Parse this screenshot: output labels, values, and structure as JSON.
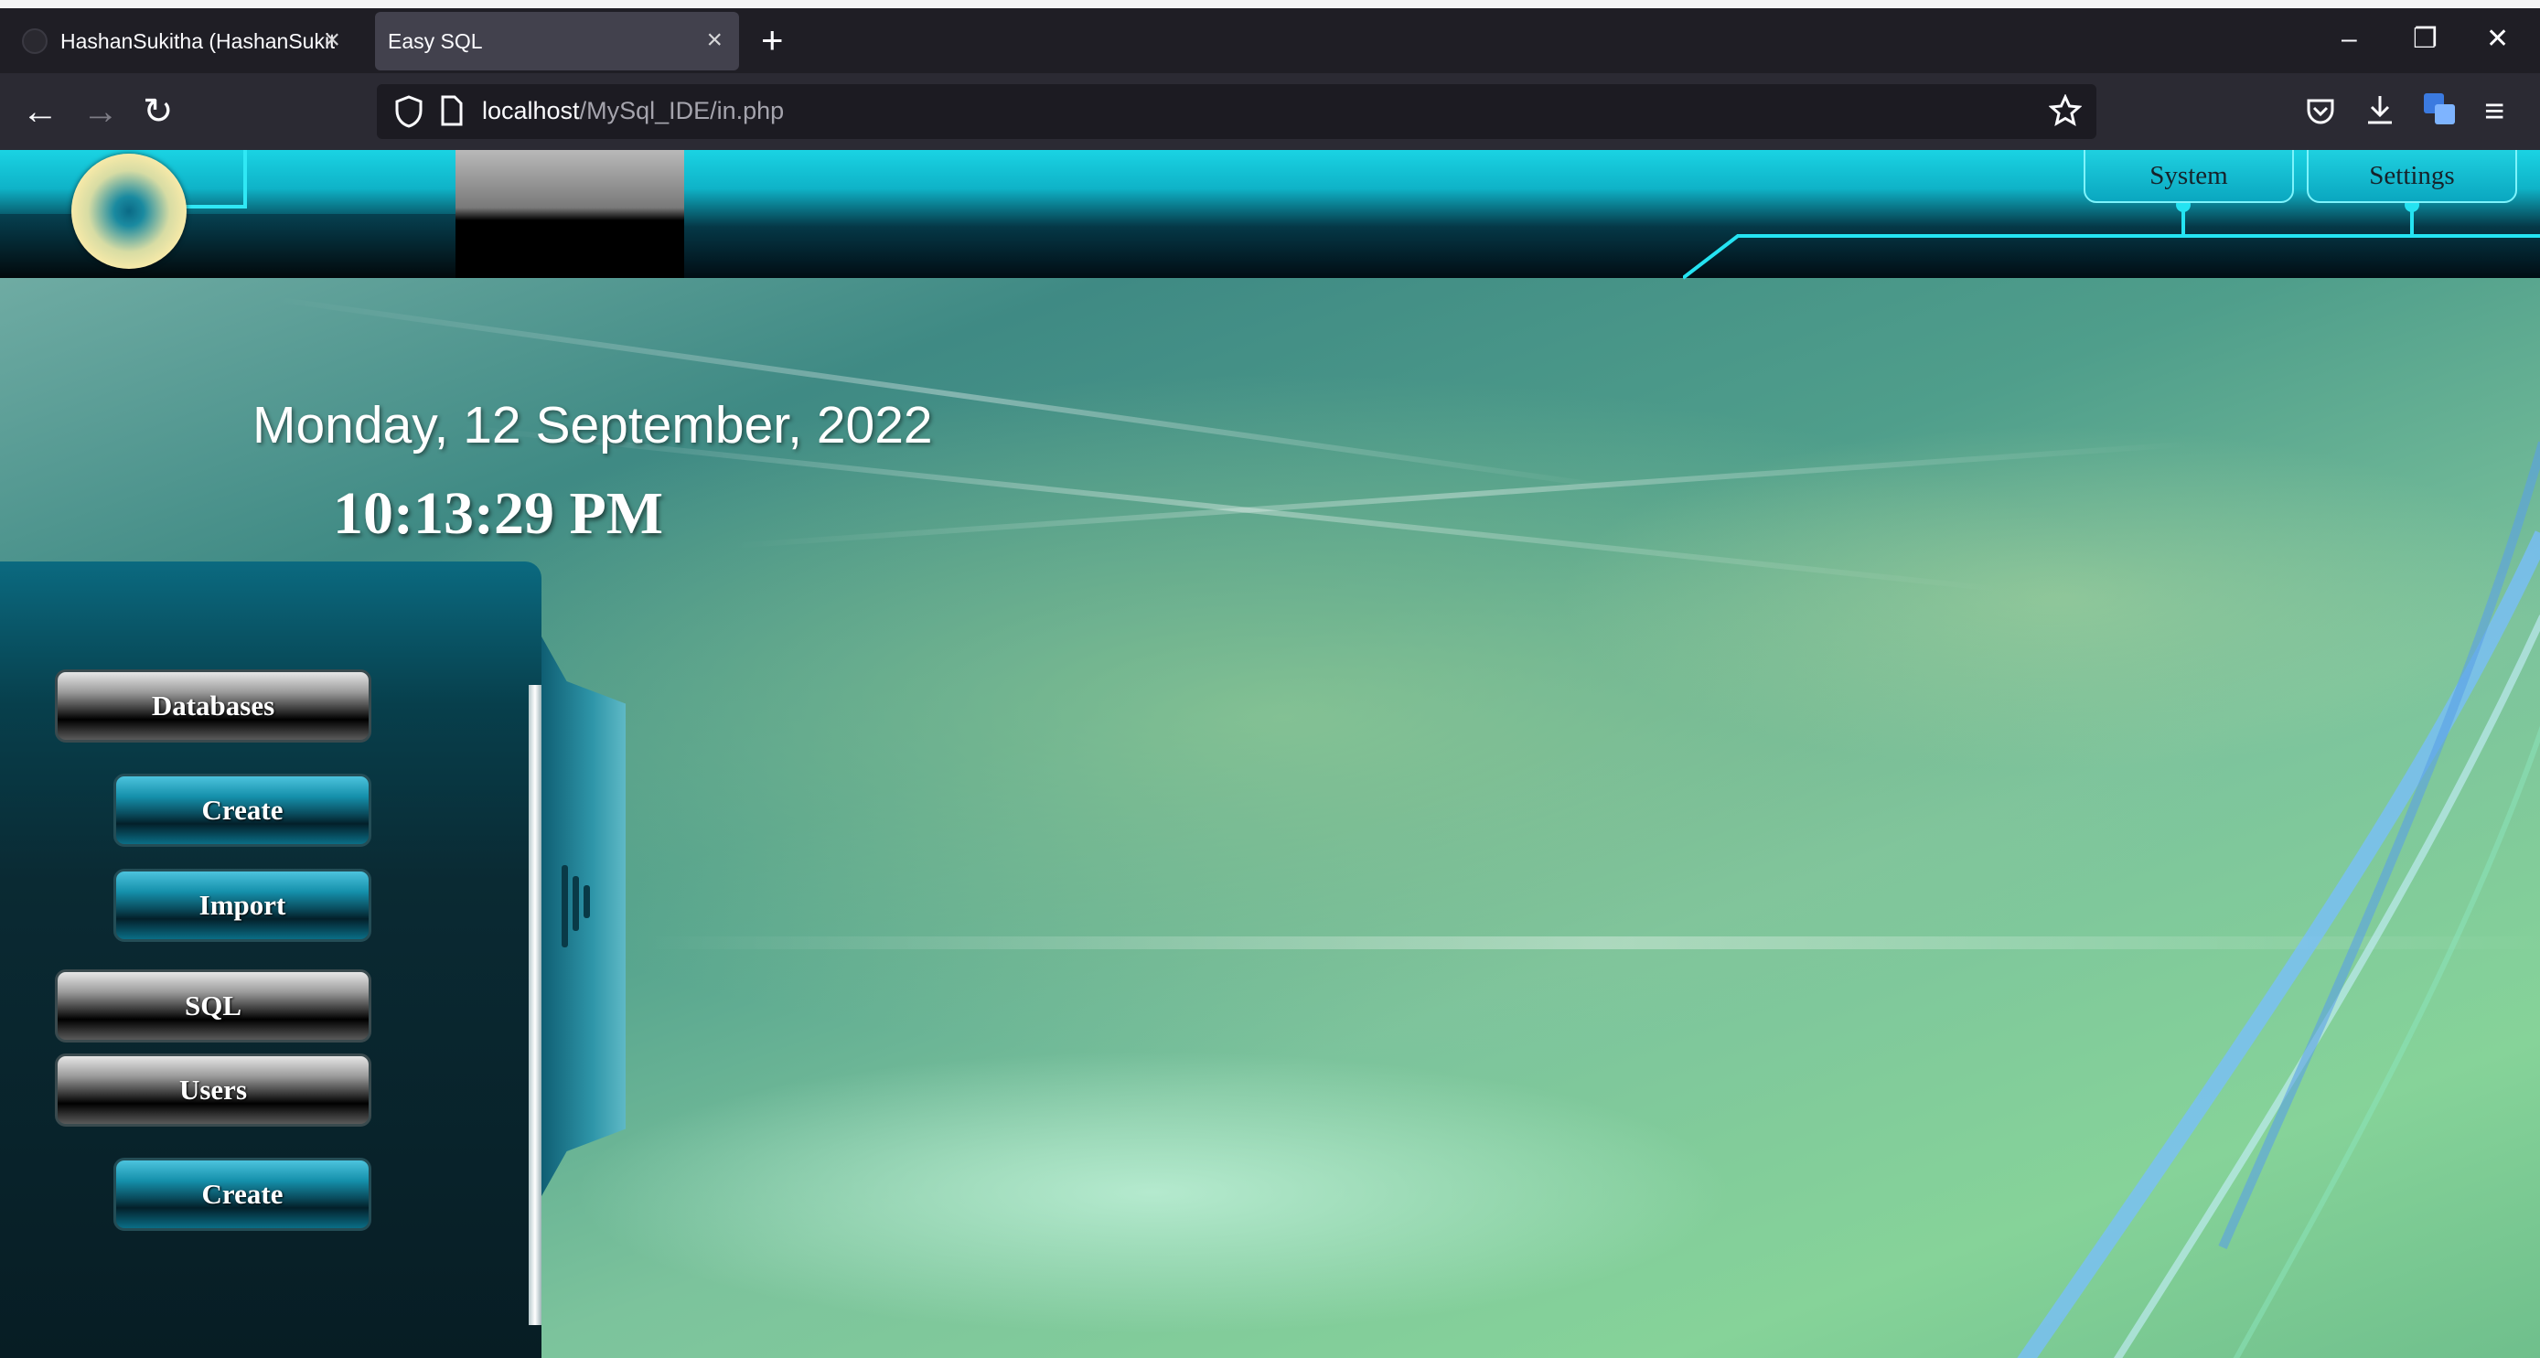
{
  "browser": {
    "tabs": [
      {
        "title": "HashanSukitha (HashanSukitha)",
        "active": false
      },
      {
        "title": "Easy SQL",
        "active": true
      }
    ],
    "new_tab_icon": "plus-icon",
    "window_controls": [
      "minimize-icon",
      "restore-icon",
      "close-icon"
    ],
    "url_host": "localhost",
    "url_path": "/MySql_IDE/in.php",
    "toolbar_icons": [
      "pocket-icon",
      "download-icon",
      "translate-icon",
      "menu-icon"
    ]
  },
  "header": {
    "menu": {
      "system_label": "System",
      "settings_label": "Settings"
    }
  },
  "clock": {
    "date": "Monday, 12 September, 2022",
    "time": "10:13:29 PM"
  },
  "sidebar": {
    "databases_label": "Databases",
    "create_db_label": "Create",
    "import_label": "Import",
    "sql_label": "SQL",
    "users_label": "Users",
    "create_user_label": "Create"
  },
  "colors": {
    "accent": "#1ad3e3",
    "sidebar_bg": "#0a2a33",
    "browser_bg": "#1f1e25"
  }
}
